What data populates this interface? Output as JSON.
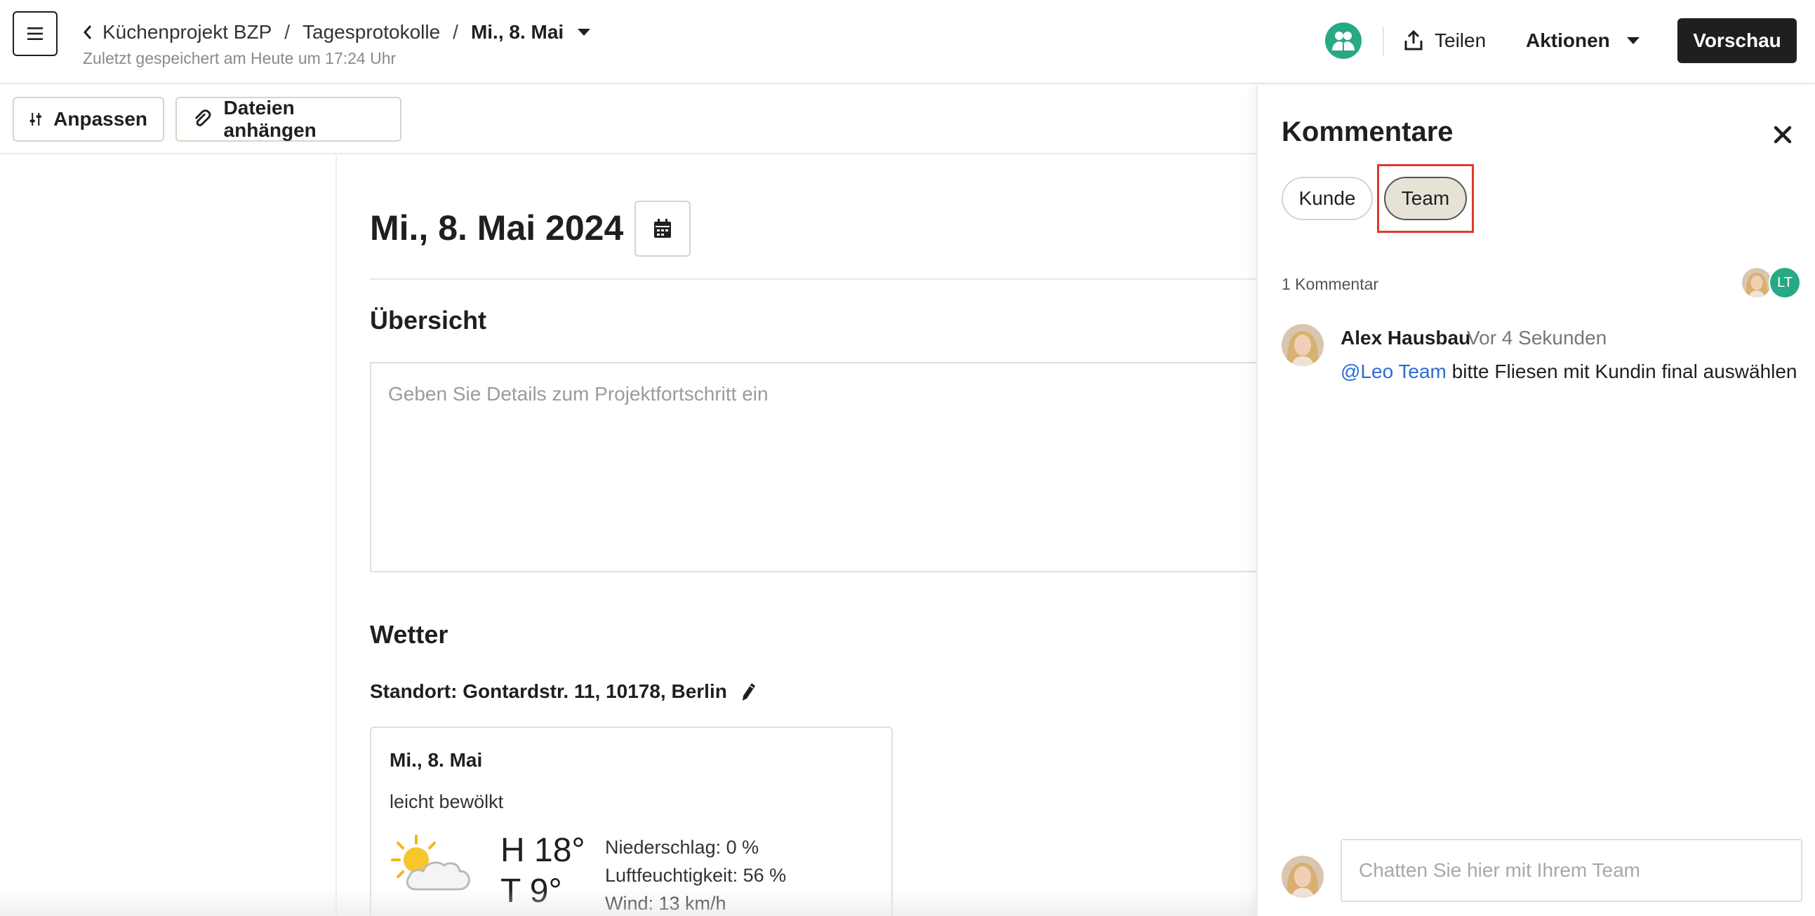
{
  "header": {
    "breadcrumb": {
      "project": "Küchenprojekt BZP",
      "section": "Tagesprotokolle",
      "current": "Mi., 8. Mai"
    },
    "saved_status": "Zuletzt gespeichert am Heute um 17:24 Uhr",
    "share_label": "Teilen",
    "actions_label": "Aktionen",
    "preview_label": "Vorschau",
    "team_avatar_color": "#29a884"
  },
  "toolbar": {
    "customize_label": "Anpassen",
    "attach_label": "Dateien anhängen"
  },
  "main": {
    "date_title": "Mi., 8. Mai 2024",
    "overview": {
      "heading": "Übersicht",
      "placeholder": "Geben Sie Details zum Projektfortschritt ein",
      "value": ""
    },
    "weather": {
      "heading": "Wetter",
      "location": "Standort: Gontardstr. 11, 10178, Berlin",
      "card": {
        "date": "Mi., 8. Mai",
        "description": "leicht bewölkt",
        "icon": "partly-cloudy-icon",
        "high": "H 18°",
        "low": "T 9°",
        "precipitation": "Niederschlag: 0 %",
        "humidity": "Luftfeuchtigkeit: 56 %",
        "wind": "Wind: 13 km/h"
      }
    }
  },
  "comments_panel": {
    "title": "Kommentare",
    "tabs": [
      {
        "label": "Kunde",
        "active": false
      },
      {
        "label": "Team",
        "active": true
      }
    ],
    "count_text": "1 Kommentar",
    "participants": [
      {
        "type": "photo"
      },
      {
        "initials": "LT",
        "color": "#29a884"
      }
    ],
    "comments": [
      {
        "author": "Alex Hausbau",
        "time": "Vor 4 Sekunden",
        "mention": "@Leo Team",
        "text": " bitte Fliesen mit Kundin final auswählen"
      }
    ],
    "chat_placeholder": "Chatten Sie hier mit Ihrem Team",
    "highlight_color": "#e03a2a",
    "mention_color": "#2c6bd6"
  }
}
